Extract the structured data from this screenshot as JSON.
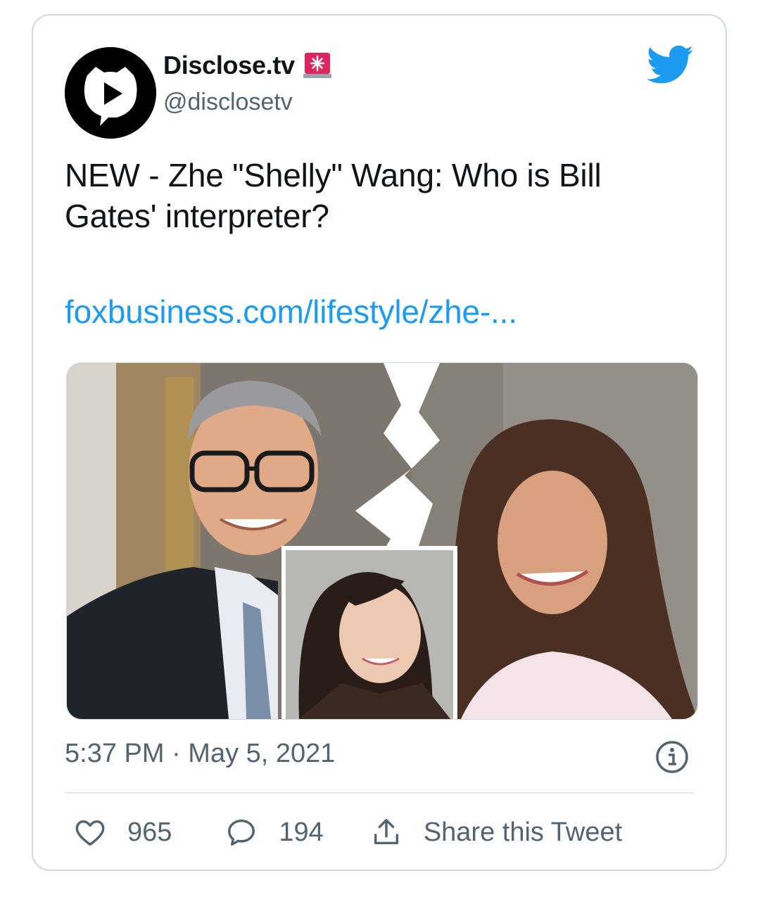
{
  "tweet": {
    "author": {
      "display_name": "Disclose.tv",
      "handle": "@disclosetv",
      "badge_icon": "siren-icon"
    },
    "text": "NEW - Zhe \"Shelly\" Wang: Who is Bill Gates' interpreter?",
    "link_text": "foxbusiness.com/lifestyle/zhe-...",
    "timestamp": "5:37 PM · May 5, 2021",
    "likes": "965",
    "replies": "194",
    "share_label": "Share this Tweet"
  },
  "colors": {
    "link": "#1d9bf0",
    "twitter_blue": "#1d9bf0",
    "secondary_text": "#536471",
    "border": "#cfd9de",
    "siren_red": "#e0245e"
  },
  "icons": {
    "logo": "twitter-bird-icon",
    "info": "info-icon",
    "like": "heart-icon",
    "reply": "reply-bubble-icon",
    "share": "share-upload-icon"
  }
}
